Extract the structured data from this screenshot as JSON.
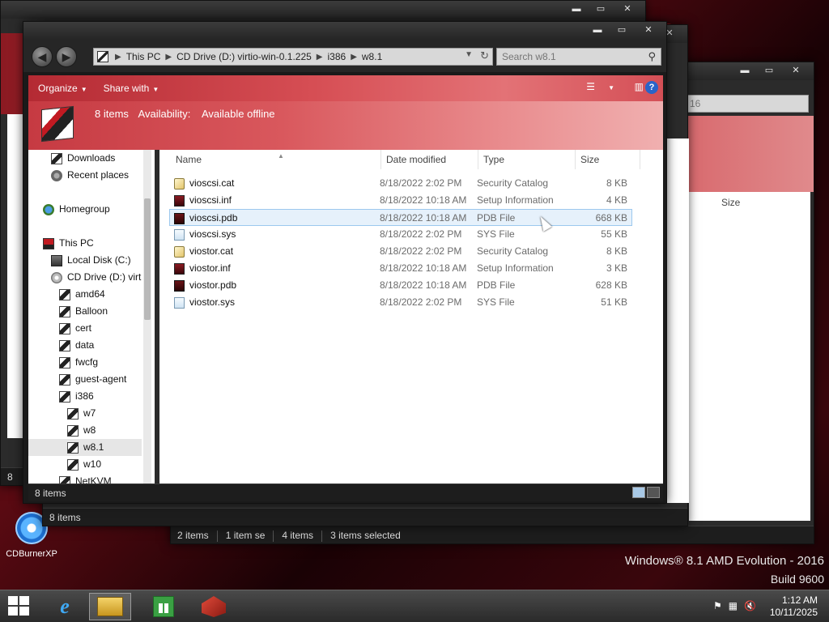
{
  "desktop": {
    "wall_logo": "16",
    "branding_line1": "Windows® 8.1 AMD Evolution - 2016",
    "branding_line2": "Build 9600",
    "icon_label": "CDBurnerXP"
  },
  "back_windows": {
    "w1_status": "8",
    "w2_status": "8 items",
    "w2_size_header": "Size",
    "w3_search": "16",
    "w3_status_a": "2 items",
    "w3_status_b": "1 item se",
    "w3_status_c": "4 items",
    "w3_status_d": "3 items selected"
  },
  "window": {
    "buttons": {
      "minimize": "▬",
      "maximize": "▭",
      "close": "✕"
    },
    "address": {
      "crumbs": [
        "This PC",
        "CD Drive (D:) virtio-win-0.1.225",
        "i386",
        "w8.1"
      ]
    },
    "search_placeholder": "Search w8.1",
    "commands": {
      "organize": "Organize",
      "share": "Share with"
    },
    "details": {
      "count": "8 items",
      "availability_label": "Availability:",
      "availability_value": "Available offline"
    },
    "nav": [
      {
        "label": "Downloads",
        "icon": "folder-icon"
      },
      {
        "label": "Recent places",
        "icon": "recent-places-icon"
      },
      {
        "label": "Homegroup",
        "icon": "homegroup-icon"
      },
      {
        "label": "This PC",
        "icon": "this-pc-icon"
      },
      {
        "label": "Local Disk (C:)",
        "icon": "drive-icon"
      },
      {
        "label": "CD Drive (D:) virt",
        "icon": "cd-drive-icon"
      },
      {
        "label": "amd64",
        "icon": "folder-icon"
      },
      {
        "label": "Balloon",
        "icon": "folder-icon"
      },
      {
        "label": "cert",
        "icon": "folder-icon"
      },
      {
        "label": "data",
        "icon": "folder-icon"
      },
      {
        "label": "fwcfg",
        "icon": "folder-icon"
      },
      {
        "label": "guest-agent",
        "icon": "folder-icon"
      },
      {
        "label": "i386",
        "icon": "folder-icon"
      },
      {
        "label": "w7",
        "icon": "folder-icon"
      },
      {
        "label": "w8",
        "icon": "folder-icon"
      },
      {
        "label": "w8.1",
        "icon": "folder-icon"
      },
      {
        "label": "w10",
        "icon": "folder-icon"
      },
      {
        "label": "NetKVM",
        "icon": "folder-icon"
      }
    ],
    "columns": {
      "name": "Name",
      "date": "Date modified",
      "type": "Type",
      "size": "Size"
    },
    "files": [
      {
        "name": "vioscsi.cat",
        "date": "8/18/2022 2:02 PM",
        "type": "Security Catalog",
        "size": "8 KB"
      },
      {
        "name": "vioscsi.inf",
        "date": "8/18/2022 10:18 AM",
        "type": "Setup Information",
        "size": "4 KB"
      },
      {
        "name": "vioscsi.pdb",
        "date": "8/18/2022 10:18 AM",
        "type": "PDB File",
        "size": "668 KB"
      },
      {
        "name": "vioscsi.sys",
        "date": "8/18/2022 2:02 PM",
        "type": "SYS File",
        "size": "55 KB"
      },
      {
        "name": "viostor.cat",
        "date": "8/18/2022 2:02 PM",
        "type": "Security Catalog",
        "size": "8 KB"
      },
      {
        "name": "viostor.inf",
        "date": "8/18/2022 10:18 AM",
        "type": "Setup Information",
        "size": "3 KB"
      },
      {
        "name": "viostor.pdb",
        "date": "8/18/2022 10:18 AM",
        "type": "PDB File",
        "size": "628 KB"
      },
      {
        "name": "viostor.sys",
        "date": "8/18/2022 2:02 PM",
        "type": "SYS File",
        "size": "51 KB"
      }
    ],
    "status": "8 items"
  },
  "taskbar": {
    "time": "1:12 AM",
    "date": "10/11/2025",
    "apps": [
      "internet-explorer-icon",
      "file-explorer-icon",
      "store-icon",
      "box-app-icon"
    ]
  },
  "colors": {
    "accent_red": "#c63a42",
    "selection_bg": "#e6f1fb",
    "selection_border": "#9cc8ee"
  }
}
